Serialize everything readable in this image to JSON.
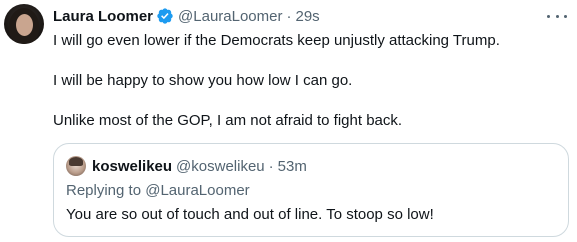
{
  "tweet": {
    "author": {
      "name": "Laura Loomer",
      "handle": "@LauraLoomer",
      "time": "29s",
      "separator": "·",
      "verified_icon": "verified-badge-icon",
      "verified_color": "#1d9bf0"
    },
    "more_icon": "more-horizontal-icon",
    "text_lines": [
      "I will go even lower if the Democrats keep unjustly attacking Trump.",
      "I will be happy to show you how low I can go.",
      "Unlike most of the GOP, I am not afraid to fight back."
    ],
    "quote": {
      "author": {
        "name": "koswelikeu",
        "handle": "@koswelikeu",
        "time": "53m",
        "separator": "·"
      },
      "replying_prefix": "Replying to ",
      "replying_to": "@LauraLoomer",
      "text": "You are so out of touch and out of line. To stoop so low!"
    }
  },
  "colors": {
    "text_primary": "#0f1419",
    "text_secondary": "#536471",
    "border": "#cfd9de",
    "accent": "#1d9bf0"
  }
}
